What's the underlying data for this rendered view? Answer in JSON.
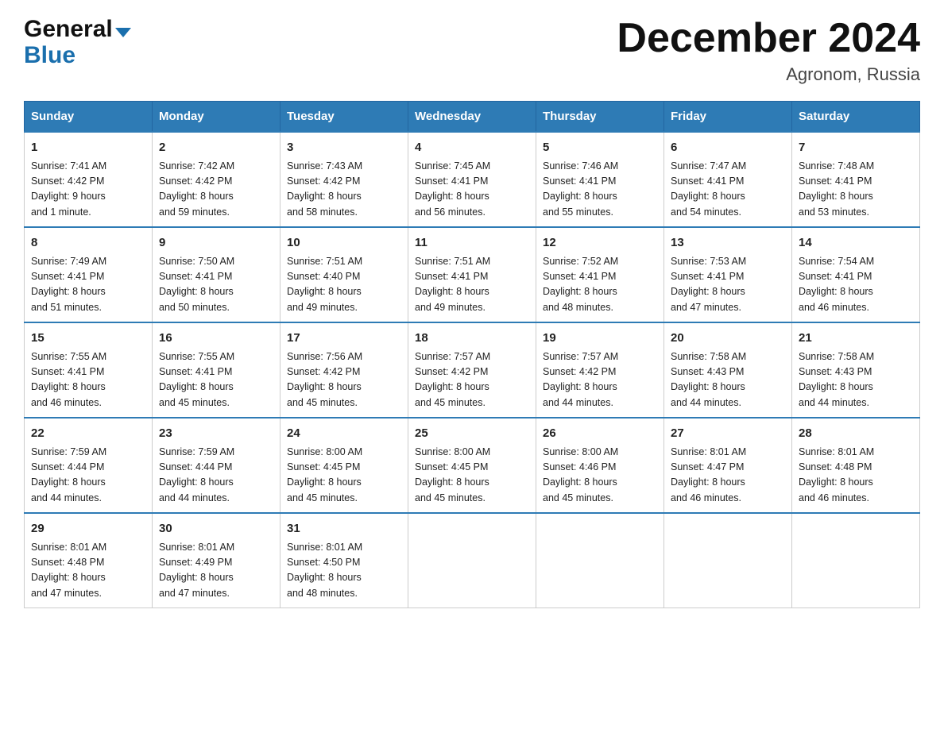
{
  "header": {
    "logo_general": "General",
    "logo_blue": "Blue",
    "month_year": "December 2024",
    "location": "Agronom, Russia"
  },
  "days_of_week": [
    "Sunday",
    "Monday",
    "Tuesday",
    "Wednesday",
    "Thursday",
    "Friday",
    "Saturday"
  ],
  "weeks": [
    [
      {
        "day": "1",
        "info": "Sunrise: 7:41 AM\nSunset: 4:42 PM\nDaylight: 9 hours\nand 1 minute."
      },
      {
        "day": "2",
        "info": "Sunrise: 7:42 AM\nSunset: 4:42 PM\nDaylight: 8 hours\nand 59 minutes."
      },
      {
        "day": "3",
        "info": "Sunrise: 7:43 AM\nSunset: 4:42 PM\nDaylight: 8 hours\nand 58 minutes."
      },
      {
        "day": "4",
        "info": "Sunrise: 7:45 AM\nSunset: 4:41 PM\nDaylight: 8 hours\nand 56 minutes."
      },
      {
        "day": "5",
        "info": "Sunrise: 7:46 AM\nSunset: 4:41 PM\nDaylight: 8 hours\nand 55 minutes."
      },
      {
        "day": "6",
        "info": "Sunrise: 7:47 AM\nSunset: 4:41 PM\nDaylight: 8 hours\nand 54 minutes."
      },
      {
        "day": "7",
        "info": "Sunrise: 7:48 AM\nSunset: 4:41 PM\nDaylight: 8 hours\nand 53 minutes."
      }
    ],
    [
      {
        "day": "8",
        "info": "Sunrise: 7:49 AM\nSunset: 4:41 PM\nDaylight: 8 hours\nand 51 minutes."
      },
      {
        "day": "9",
        "info": "Sunrise: 7:50 AM\nSunset: 4:41 PM\nDaylight: 8 hours\nand 50 minutes."
      },
      {
        "day": "10",
        "info": "Sunrise: 7:51 AM\nSunset: 4:40 PM\nDaylight: 8 hours\nand 49 minutes."
      },
      {
        "day": "11",
        "info": "Sunrise: 7:51 AM\nSunset: 4:41 PM\nDaylight: 8 hours\nand 49 minutes."
      },
      {
        "day": "12",
        "info": "Sunrise: 7:52 AM\nSunset: 4:41 PM\nDaylight: 8 hours\nand 48 minutes."
      },
      {
        "day": "13",
        "info": "Sunrise: 7:53 AM\nSunset: 4:41 PM\nDaylight: 8 hours\nand 47 minutes."
      },
      {
        "day": "14",
        "info": "Sunrise: 7:54 AM\nSunset: 4:41 PM\nDaylight: 8 hours\nand 46 minutes."
      }
    ],
    [
      {
        "day": "15",
        "info": "Sunrise: 7:55 AM\nSunset: 4:41 PM\nDaylight: 8 hours\nand 46 minutes."
      },
      {
        "day": "16",
        "info": "Sunrise: 7:55 AM\nSunset: 4:41 PM\nDaylight: 8 hours\nand 45 minutes."
      },
      {
        "day": "17",
        "info": "Sunrise: 7:56 AM\nSunset: 4:42 PM\nDaylight: 8 hours\nand 45 minutes."
      },
      {
        "day": "18",
        "info": "Sunrise: 7:57 AM\nSunset: 4:42 PM\nDaylight: 8 hours\nand 45 minutes."
      },
      {
        "day": "19",
        "info": "Sunrise: 7:57 AM\nSunset: 4:42 PM\nDaylight: 8 hours\nand 44 minutes."
      },
      {
        "day": "20",
        "info": "Sunrise: 7:58 AM\nSunset: 4:43 PM\nDaylight: 8 hours\nand 44 minutes."
      },
      {
        "day": "21",
        "info": "Sunrise: 7:58 AM\nSunset: 4:43 PM\nDaylight: 8 hours\nand 44 minutes."
      }
    ],
    [
      {
        "day": "22",
        "info": "Sunrise: 7:59 AM\nSunset: 4:44 PM\nDaylight: 8 hours\nand 44 minutes."
      },
      {
        "day": "23",
        "info": "Sunrise: 7:59 AM\nSunset: 4:44 PM\nDaylight: 8 hours\nand 44 minutes."
      },
      {
        "day": "24",
        "info": "Sunrise: 8:00 AM\nSunset: 4:45 PM\nDaylight: 8 hours\nand 45 minutes."
      },
      {
        "day": "25",
        "info": "Sunrise: 8:00 AM\nSunset: 4:45 PM\nDaylight: 8 hours\nand 45 minutes."
      },
      {
        "day": "26",
        "info": "Sunrise: 8:00 AM\nSunset: 4:46 PM\nDaylight: 8 hours\nand 45 minutes."
      },
      {
        "day": "27",
        "info": "Sunrise: 8:01 AM\nSunset: 4:47 PM\nDaylight: 8 hours\nand 46 minutes."
      },
      {
        "day": "28",
        "info": "Sunrise: 8:01 AM\nSunset: 4:48 PM\nDaylight: 8 hours\nand 46 minutes."
      }
    ],
    [
      {
        "day": "29",
        "info": "Sunrise: 8:01 AM\nSunset: 4:48 PM\nDaylight: 8 hours\nand 47 minutes."
      },
      {
        "day": "30",
        "info": "Sunrise: 8:01 AM\nSunset: 4:49 PM\nDaylight: 8 hours\nand 47 minutes."
      },
      {
        "day": "31",
        "info": "Sunrise: 8:01 AM\nSunset: 4:50 PM\nDaylight: 8 hours\nand 48 minutes."
      },
      {
        "day": "",
        "info": ""
      },
      {
        "day": "",
        "info": ""
      },
      {
        "day": "",
        "info": ""
      },
      {
        "day": "",
        "info": ""
      }
    ]
  ]
}
